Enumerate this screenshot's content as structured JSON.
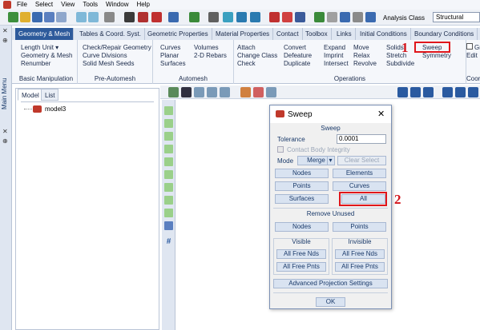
{
  "menubar": {
    "items": [
      "File",
      "Select",
      "View",
      "Tools",
      "Window",
      "Help"
    ]
  },
  "toolbar": {
    "analysis_label": "Analysis Class",
    "analysis_value": "Structural"
  },
  "side": {
    "main_menu_label": "Main Menu"
  },
  "tabs": [
    "Geometry & Mesh",
    "Tables & Coord. Syst.",
    "Geometric Properties",
    "Material Properties",
    "Contact",
    "Toolbox",
    "Links",
    "Initial Conditions",
    "Boundary Conditions"
  ],
  "ribbon": {
    "basic": {
      "items": [
        "Length Unit ▾",
        "Geometry & Mesh",
        "Renumber"
      ],
      "title": "Basic Manipulation"
    },
    "preautomesh": {
      "items": [
        "Check/Repair Geometry",
        "Curve Divisions",
        "Solid Mesh Seeds"
      ],
      "title": "Pre-Automesh"
    },
    "automesh": {
      "col1": [
        "Curves",
        "Planar",
        "Surfaces"
      ],
      "col2": [
        "Volumes",
        "2-D Rebars"
      ],
      "title": "Automesh"
    },
    "operations": {
      "col1": [
        "Attach",
        "Change Class",
        "Check"
      ],
      "col2": [
        "Convert",
        "Defeature",
        "Duplicate"
      ],
      "col3": [
        "Expand",
        "Imprint",
        "Intersect"
      ],
      "col4": [
        "Move",
        "Relax",
        "Revolve"
      ],
      "col5": [
        "Solids",
        "Stretch",
        "Subdivide"
      ],
      "col6": [
        "Sweep",
        "Symmetry"
      ],
      "title": "Operations"
    },
    "extra": {
      "items": [
        "Gr",
        "Edit"
      ],
      "title": "Coordi"
    }
  },
  "annotations": {
    "one": "1",
    "two": "2"
  },
  "tree": {
    "tabs": [
      "Model",
      "List"
    ],
    "root": "model3"
  },
  "dialog": {
    "title": "Sweep",
    "sweep_section": "Sweep",
    "tolerance_label": "Tolerance",
    "tolerance_value": "0.0001",
    "contact_body_label": "Contact Body Integrity",
    "mode_label": "Mode",
    "mode_value": "Merge",
    "clear_select": "Clear Select",
    "buttons": {
      "nodes": "Nodes",
      "elements": "Elements",
      "points": "Points",
      "curves": "Curves",
      "surfaces": "Surfaces",
      "all": "All"
    },
    "remove_unused_section": "Remove Unused",
    "remove_nodes": "Nodes",
    "remove_points": "Points",
    "visible_section": "Visible",
    "invisible_section": "Invisible",
    "vis_free_nds": "All Free Nds",
    "vis_free_pnts": "All Free Pnts",
    "invis_free_nds": "All Free Nds",
    "invis_free_pnts": "All Free Pnts",
    "advanced": "Advanced Projection Settings",
    "ok": "OK"
  },
  "colors": {
    "accent": "#2d5a9b",
    "highlight": "#e0161b",
    "dialog_bg": "#f0f0f0"
  }
}
